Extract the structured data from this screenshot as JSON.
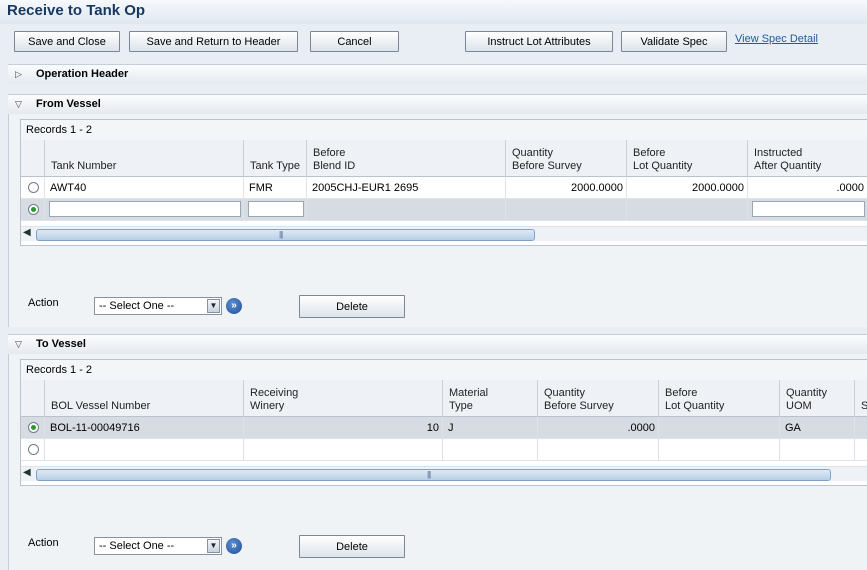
{
  "page": {
    "title": "Receive to Tank Op"
  },
  "toolbar": {
    "save_close": "Save and Close",
    "save_return": "Save and Return to Header",
    "cancel": "Cancel",
    "instruct_lot": "Instruct Lot Attributes",
    "validate_spec": "Validate Spec",
    "view_spec_link": "View Spec Detail"
  },
  "operation_header": {
    "label": "Operation Header"
  },
  "from_vessel": {
    "label": "From Vessel",
    "records": "Records 1 - 2",
    "columns": [
      "Tank Number",
      "Tank Type",
      "Before\nBlend ID",
      "Quantity\nBefore Survey",
      "Before\nLot Quantity",
      "Instructed\nAfter Quantity"
    ],
    "rows": [
      {
        "tank_number": "AWT40",
        "tank_type": "FMR",
        "blend_id": "2005CHJ-EUR1  2695",
        "qty_before_survey": "2000.0000",
        "lot_qty": "2000.0000",
        "after_qty": ".0000"
      }
    ],
    "action_label": "Action",
    "action_select": "-- Select One --",
    "delete": "Delete"
  },
  "to_vessel": {
    "label": "To Vessel",
    "records": "Records 1 - 2",
    "columns": [
      "BOL Vessel Number",
      "Receiving\nWinery",
      "Material\nType",
      "Quantity\nBefore Survey",
      "Before\nLot Quantity",
      "Quantity\nUOM",
      "S"
    ],
    "rows": [
      {
        "bol": "BOL-11-00049716",
        "winery": "10",
        "material_type": "J",
        "qty_before_survey": ".0000",
        "lot_qty": "",
        "uom": "GA"
      }
    ],
    "action_label": "Action",
    "action_select": "-- Select One --",
    "delete": "Delete"
  },
  "icons": {
    "expand": "triangle-right-icon",
    "collapse": "triangle-down-icon",
    "go": "go-arrow-icon"
  }
}
